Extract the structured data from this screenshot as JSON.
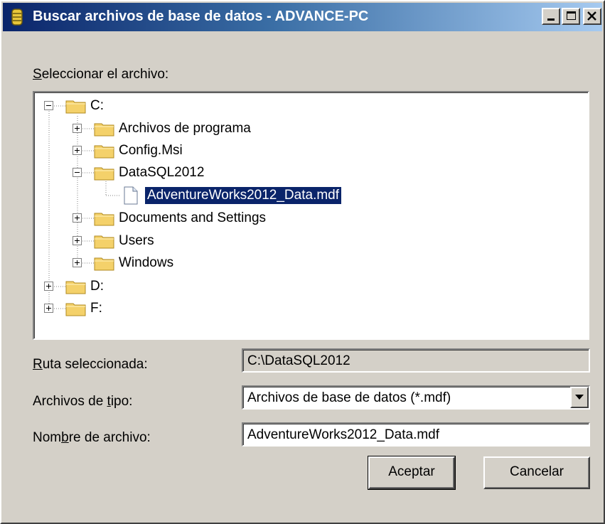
{
  "window": {
    "title": "Buscar archivos de base de datos - ADVANCE-PC",
    "controls": {
      "minimize": "minimize",
      "maximize": "maximize",
      "close": "close"
    }
  },
  "select_label_prefix": "S",
  "select_label_rest": "eleccionar el archivo:",
  "tree": [
    {
      "label": "C:",
      "expanded": true,
      "children": [
        {
          "label": "Archivos de programa",
          "expanded": false
        },
        {
          "label": "Config.Msi",
          "expanded": false
        },
        {
          "label": "DataSQL2012",
          "expanded": true,
          "children": [
            {
              "label": "AdventureWorks2012_Data.mdf",
              "type": "file",
              "selected": true
            }
          ]
        },
        {
          "label": "Documents and Settings",
          "expanded": false
        },
        {
          "label": "Users",
          "expanded": false
        },
        {
          "label": "Windows",
          "expanded": false
        }
      ]
    },
    {
      "label": "D:",
      "expanded": false
    },
    {
      "label": "F:",
      "expanded": false
    }
  ],
  "ruta": {
    "label_prefix": "R",
    "label_rest": "uta seleccionada:",
    "value": "C:\\DataSQL2012"
  },
  "tipo": {
    "label_a": "Archivos de ",
    "label_u": "t",
    "label_b": "ipo:",
    "value": "Archivos de base de datos (*.mdf)"
  },
  "nombre": {
    "label_a": "Nom",
    "label_u": "b",
    "label_b": "re de archivo:",
    "value": "AdventureWorks2012_Data.mdf"
  },
  "buttons": {
    "accept": "Aceptar",
    "cancel": "Cancelar"
  },
  "colors": {
    "selection": "#0a246a",
    "dialog_bg": "#d4d0c8",
    "folder": "#f4d16a"
  }
}
